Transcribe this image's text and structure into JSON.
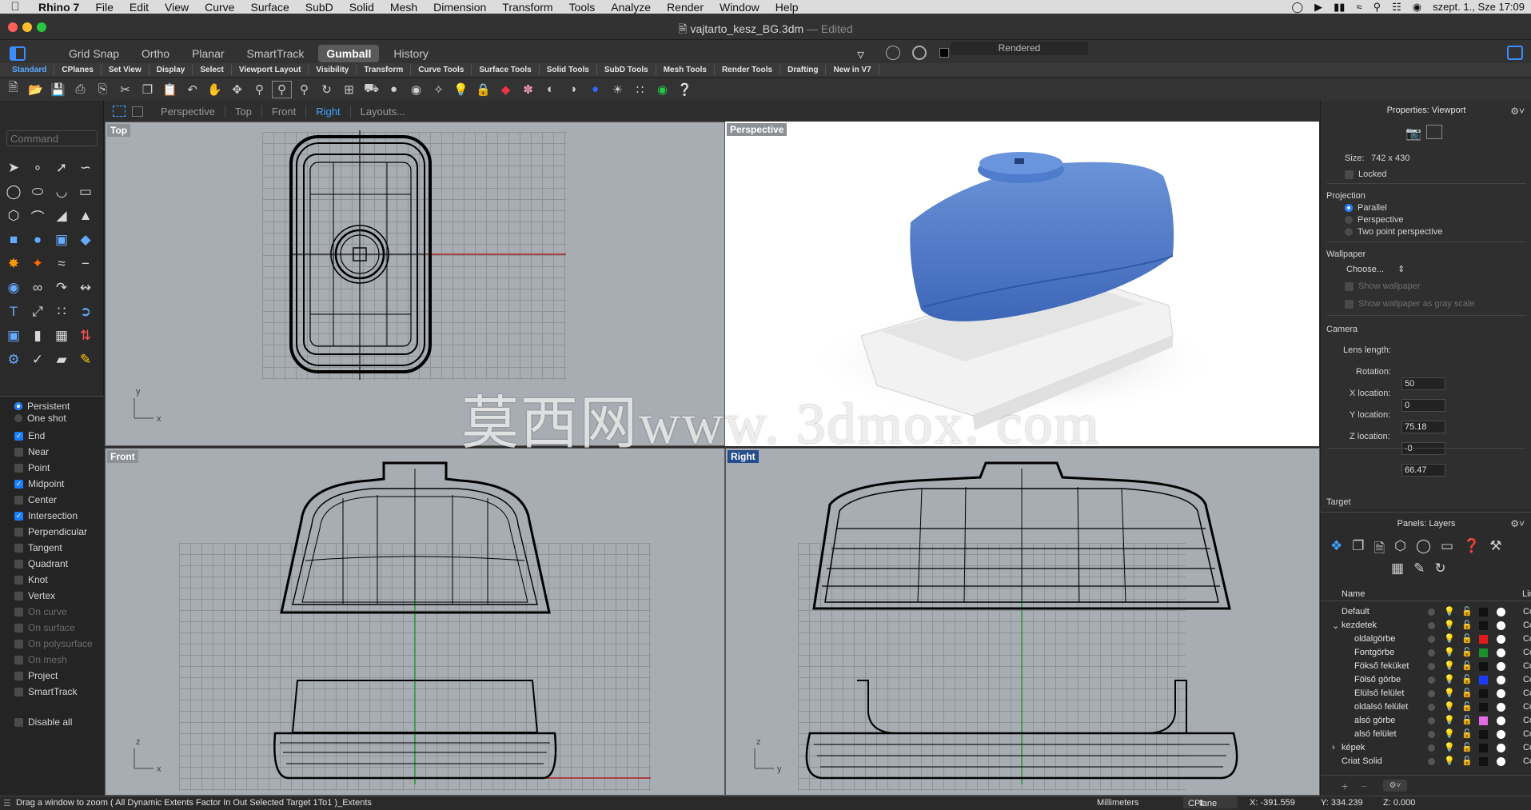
{
  "mac_menu": {
    "app": "Rhino 7",
    "items": [
      "File",
      "Edit",
      "View",
      "Curve",
      "Surface",
      "SubD",
      "Solid",
      "Mesh",
      "Dimension",
      "Transform",
      "Tools",
      "Analyze",
      "Render",
      "Window",
      "Help"
    ],
    "clock": "szept. 1., Sze  17:09"
  },
  "window": {
    "filename": "vajtarto_kesz_BG.3dm",
    "separator": "—",
    "state": "Edited"
  },
  "modes": [
    "Grid Snap",
    "Ortho",
    "Planar",
    "SmartTrack",
    "Gumball",
    "History"
  ],
  "active_mode": "Gumball",
  "display_mode": "Rendered",
  "tool_tabs": [
    "Standard",
    "CPlanes",
    "Set View",
    "Display",
    "Select",
    "Viewport Layout",
    "Visibility",
    "Transform",
    "Curve Tools",
    "Surface Tools",
    "Solid Tools",
    "SubD Tools",
    "Mesh Tools",
    "Render Tools",
    "Drafting",
    "New in V7"
  ],
  "active_tool_tab": "Standard",
  "viewport_tabs": [
    "Perspective",
    "Top",
    "Front",
    "Right",
    "Layouts..."
  ],
  "active_viewport_tab": "Right",
  "command_placeholder": "Command",
  "viewports": {
    "top": "Top",
    "perspective": "Perspective",
    "front": "Front",
    "right": "Right"
  },
  "osnap": {
    "persistent": "Persistent",
    "one_shot": "One shot",
    "items": [
      {
        "label": "End",
        "checked": true
      },
      {
        "label": "Near",
        "checked": false
      },
      {
        "label": "Point",
        "checked": false
      },
      {
        "label": "Midpoint",
        "checked": true
      },
      {
        "label": "Center",
        "checked": false
      },
      {
        "label": "Intersection",
        "checked": true
      },
      {
        "label": "Perpendicular",
        "checked": false
      },
      {
        "label": "Tangent",
        "checked": false
      },
      {
        "label": "Quadrant",
        "checked": false
      },
      {
        "label": "Knot",
        "checked": false
      },
      {
        "label": "Vertex",
        "checked": false
      },
      {
        "label": "On curve",
        "checked": false
      },
      {
        "label": "On surface",
        "checked": false
      },
      {
        "label": "On polysurface",
        "checked": false
      },
      {
        "label": "On mesh",
        "checked": false
      },
      {
        "label": "Project",
        "checked": false
      },
      {
        "label": "SmartTrack",
        "checked": false
      }
    ],
    "disable_all": "Disable all"
  },
  "properties": {
    "title": "Properties: Viewport",
    "size_label": "Size:",
    "size_value": "742 x 430",
    "locked": "Locked",
    "projection_label": "Projection",
    "projection_options": [
      "Parallel",
      "Perspective",
      "Two point perspective"
    ],
    "projection_selected": "Parallel",
    "wallpaper_label": "Wallpaper",
    "wallpaper_choose": "Choose...",
    "show_wallpaper": "Show wallpaper",
    "show_gray": "Show wallpaper as gray scale",
    "camera_label": "Camera",
    "lens_label": "Lens length:",
    "lens_value": "50",
    "rotation_label": "Rotation:",
    "rotation_value": "0",
    "x_label": "X location:",
    "x_value": "75.18",
    "y_label": "Y location:",
    "y_value": "-0",
    "z_label": "Z location:",
    "z_value": "66.47",
    "target_label": "Target"
  },
  "layers": {
    "title": "Panels: Layers",
    "col_name": "Name",
    "col_lin": "Lin",
    "rows": [
      {
        "name": "Default",
        "indent": 0,
        "color": "#111111",
        "expand": ""
      },
      {
        "name": "kezdetek",
        "indent": 0,
        "color": "#111111",
        "expand": "v"
      },
      {
        "name": "oldalgörbe",
        "indent": 1,
        "color": "#e01b1b",
        "expand": ""
      },
      {
        "name": "Fontgörbe",
        "indent": 1,
        "color": "#1a8f2a",
        "expand": ""
      },
      {
        "name": "Fökső feküket",
        "indent": 1,
        "color": "#111111",
        "expand": ""
      },
      {
        "name": "Fölső görbe",
        "indent": 1,
        "color": "#1a3cff",
        "expand": ""
      },
      {
        "name": "Elülső felület",
        "indent": 1,
        "color": "#111111",
        "expand": ""
      },
      {
        "name": "oldalsó felület",
        "indent": 1,
        "color": "#111111",
        "expand": ""
      },
      {
        "name": "alsó görbe",
        "indent": 1,
        "color": "#e36be3",
        "expand": ""
      },
      {
        "name": "alsó felület",
        "indent": 1,
        "color": "#111111",
        "expand": ""
      },
      {
        "name": "képek",
        "indent": 0,
        "color": "#111111",
        "expand": ">"
      },
      {
        "name": "Criat Solid",
        "indent": 0,
        "color": "#111111",
        "expand": ""
      }
    ],
    "co": "Co"
  },
  "status": {
    "prompt": "Drag a window to zoom ( All Dynamic Extents Factor In Out Selected Target 1To1 )_Extents",
    "units": "Millimeters",
    "cplane": "CPlane",
    "x": "X: -391.559",
    "y": "Y: 334.239",
    "z": "Z: 0.000"
  },
  "watermark": "莫西网www. 3dmox. com"
}
